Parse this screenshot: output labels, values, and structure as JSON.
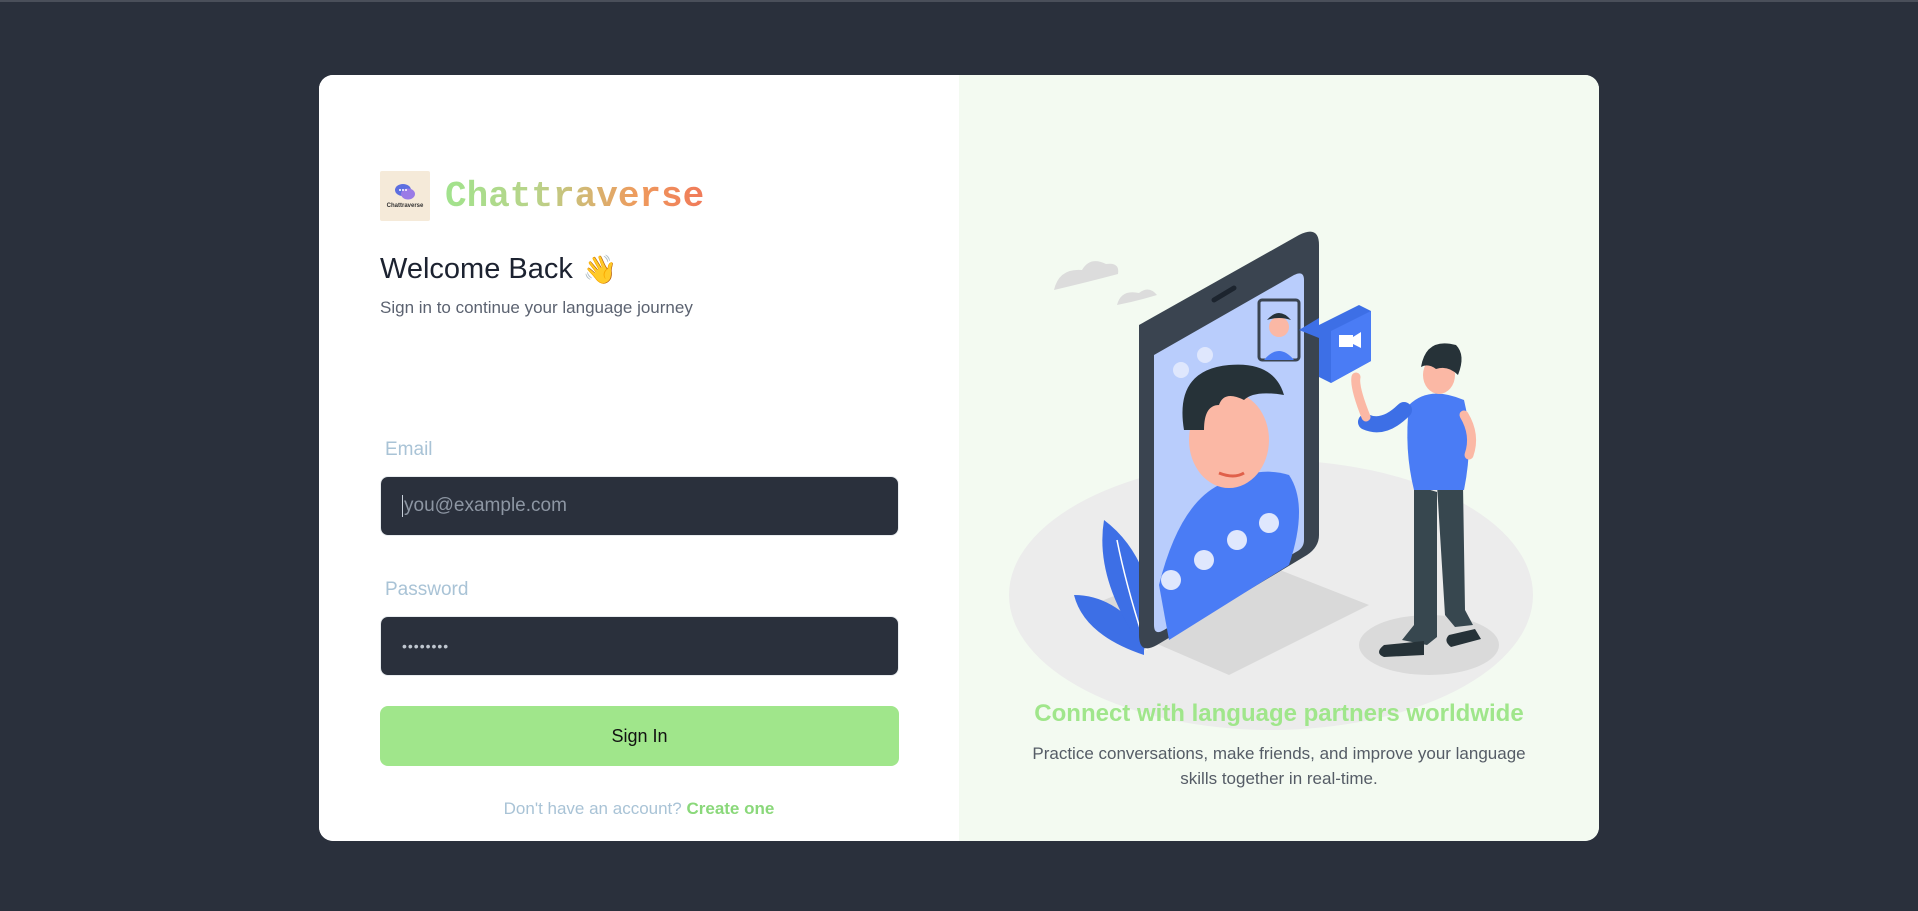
{
  "brand": {
    "logo_text": "Chattraverse",
    "name": "Chattraverse"
  },
  "login": {
    "title": "Welcome Back",
    "wave_emoji": "👋",
    "subtitle": "Sign in to continue your language journey",
    "email_label": "Email",
    "email_placeholder": "you@example.com",
    "password_label": "Password",
    "password_value": "••••••••",
    "submit_label": "Sign In",
    "signup_prompt": "Don't have an account?",
    "signup_link": "Create one"
  },
  "promo": {
    "tagline": "Connect with language partners worldwide",
    "description": "Practice conversations, make friends, and improve your language skills together in real-time."
  },
  "colors": {
    "background": "#2a303c",
    "accent": "#a0e68b",
    "input_bg": "#2a303c",
    "label": "#a9c3d6",
    "illustration_blue": "#4a7cf5"
  }
}
